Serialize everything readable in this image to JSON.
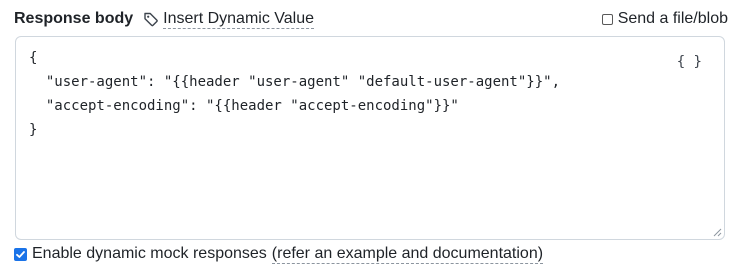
{
  "header": {
    "label": "Response body",
    "dynamic_value_link": "Insert Dynamic Value",
    "send_file_label": "Send a file/blob",
    "send_file_checked": false
  },
  "editor": {
    "content": "{\n  \"user-agent\": \"{{header \"user-agent\" \"default-user-agent\"}}\",\n  \"accept-encoding\": \"{{header \"accept-encoding\"}}\"\n}",
    "format_button": "{ }"
  },
  "footer": {
    "enable_label": "Enable dynamic mock responses",
    "enable_checked": true,
    "doc_link": "(refer an example and documentation)"
  },
  "colors": {
    "accent": "#1a73e8",
    "border": "#d0d7de",
    "text": "#1f2328"
  },
  "icons": {
    "tag": "tag-icon",
    "checkmark": "check-icon",
    "resize": "resize-handle-icon"
  }
}
